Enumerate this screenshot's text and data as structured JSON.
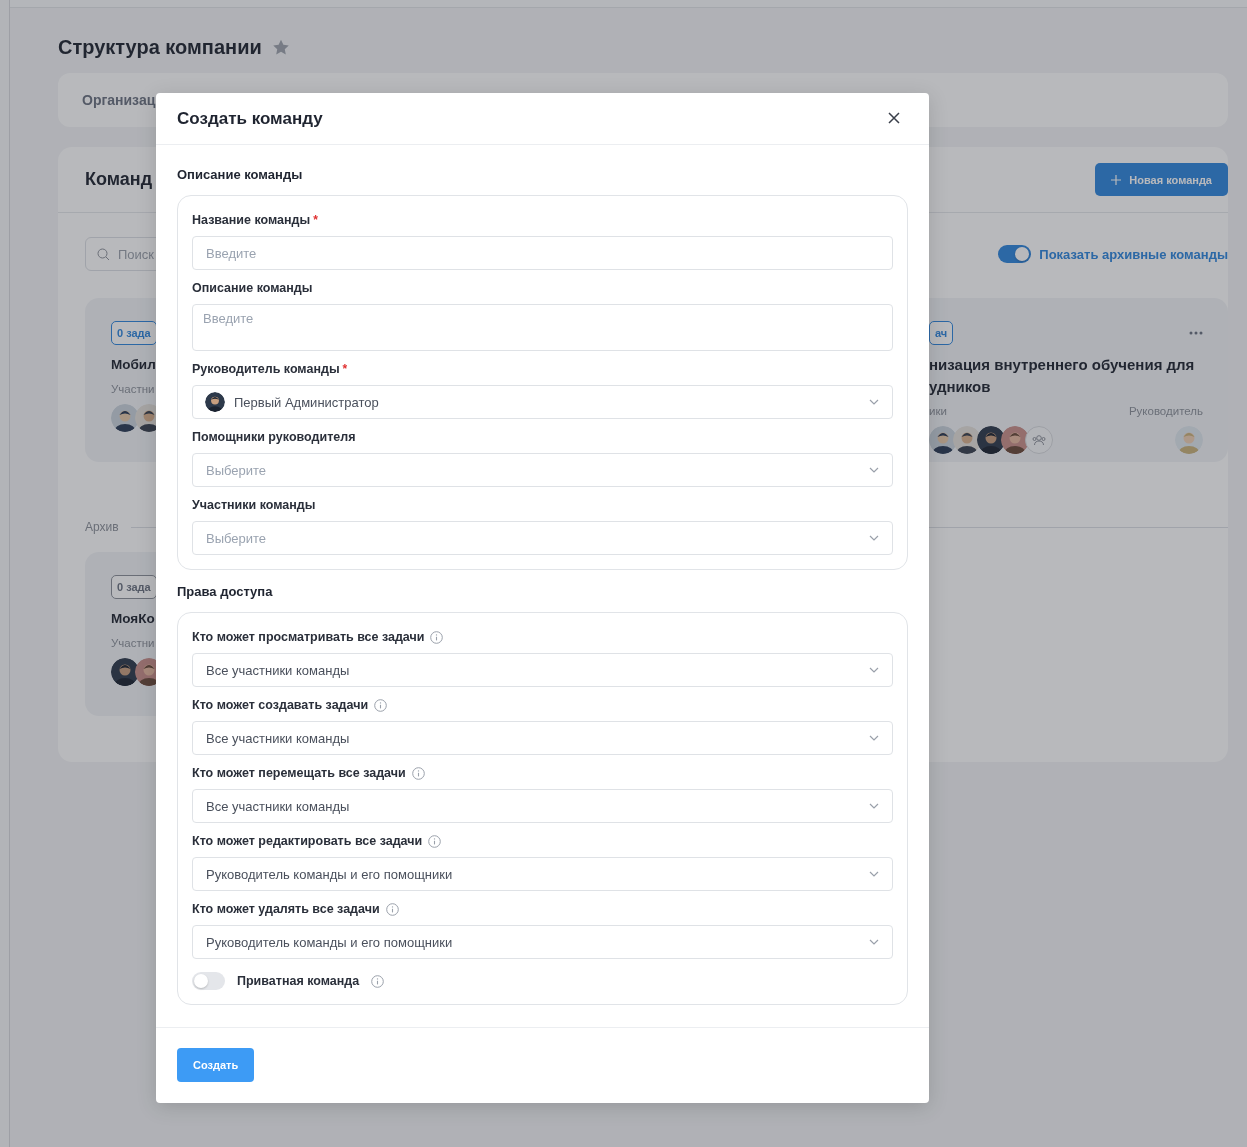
{
  "page": {
    "title": "Структура компании"
  },
  "tabs_bar": {
    "tab_1": "Организац"
  },
  "teams_panel": {
    "title": "Команд",
    "new_button": "Новая команда",
    "search": {
      "placeholder": "Поиск"
    },
    "archive_toggle": {
      "label": "Показать архивные команды",
      "on": true
    },
    "cards": [
      {
        "badge": "0 зада",
        "name_lines": [
          "Мобил"
        ],
        "members_label": "Участни",
        "members": [
          {
            "kind": "picture"
          },
          {
            "kind": "picture"
          }
        ]
      },
      {
        "badge": "ач",
        "name_lines": [
          "низация внутреннего обучения для",
          "удников"
        ],
        "members_label": "ики",
        "leader_label": "Руководитель",
        "menu": true,
        "group_button": true,
        "members": [
          {
            "kind": "picture"
          },
          {
            "kind": "picture"
          },
          {
            "kind": "picture"
          },
          {
            "kind": "picture"
          }
        ],
        "leader": {
          "kind": "picture"
        }
      }
    ]
  },
  "archive": {
    "label": "Архив",
    "cards": [
      {
        "badge": "0 зада",
        "name_lines": [
          "МояКо"
        ],
        "members_label": "Участни",
        "members": [
          {
            "kind": "picture"
          },
          {
            "kind": "picture"
          }
        ]
      }
    ]
  },
  "modal": {
    "title": "Создать команду",
    "sections": [
      {
        "title": "Описание команды",
        "fields": [
          {
            "kind": "text",
            "label": "Название команды",
            "required_mark": "*",
            "placeholder": "Введите"
          },
          {
            "kind": "textarea",
            "label": "Описание команды",
            "placeholder": "Введите"
          },
          {
            "kind": "user-select",
            "label": "Руководитель команды",
            "required_mark": "*",
            "value": "Первый Администратор"
          },
          {
            "kind": "select",
            "label": "Помощники руководителя",
            "placeholder": "Выберите"
          },
          {
            "kind": "select",
            "label": "Участники команды",
            "placeholder": "Выберите"
          }
        ]
      },
      {
        "title": "Права доступа",
        "fields": [
          {
            "kind": "select",
            "label": "Кто может просматривать все задачи",
            "info": true,
            "value": "Все участники команды"
          },
          {
            "kind": "select",
            "label": "Кто может создавать задачи",
            "info": true,
            "value": "Все участники команды"
          },
          {
            "kind": "select",
            "label": "Кто может перемещать все задачи",
            "info": true,
            "value": "Все участники команды"
          },
          {
            "kind": "select",
            "label": "Кто может редактировать все задачи",
            "info": true,
            "value": "Руководитель команды и его помощники"
          },
          {
            "kind": "select",
            "label": "Кто может удалять все задачи",
            "info": true,
            "value": "Руководитель команды и его помощники"
          },
          {
            "kind": "switch",
            "label": "Приватная команда",
            "info": true,
            "on": false
          }
        ]
      }
    ],
    "submit": "Создать"
  }
}
